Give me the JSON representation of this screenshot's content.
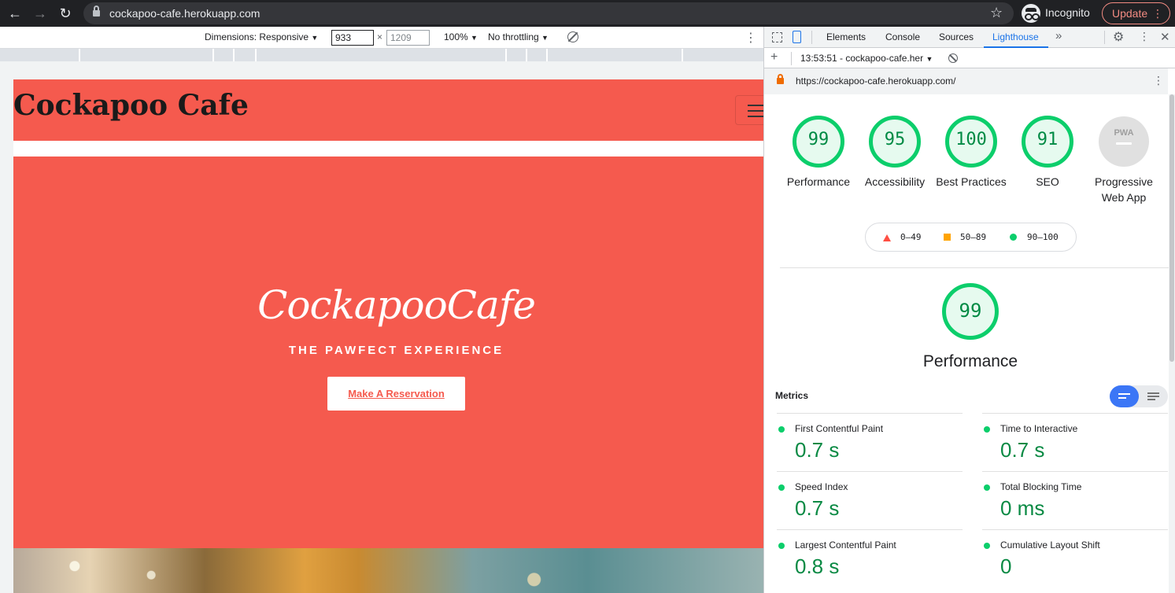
{
  "browser": {
    "url": "cockapoo-cafe.herokuapp.com",
    "incognito_label": "Incognito",
    "update_label": "Update"
  },
  "device_toolbar": {
    "dimensions_label": "Dimensions: Responsive",
    "width": "933",
    "height_placeholder": "1209",
    "zoom": "100%",
    "throttling": "No throttling"
  },
  "site": {
    "brand": "Cockapoo Cafe",
    "hero_logo": "CockapooCafe",
    "hero_tagline": "THE PAWFECT EXPERIENCE",
    "cta_label": "Make A Reservation",
    "brand_color": "#f55a4e"
  },
  "devtools": {
    "tabs": [
      "Elements",
      "Console",
      "Sources",
      "Lighthouse"
    ],
    "active_tab": "Lighthouse",
    "more_tabs": "»",
    "report_label": "13:53:51 - cockapoo-cafe.her",
    "report_url": "https://cockapoo-cafe.herokuapp.com/"
  },
  "lighthouse": {
    "categories": [
      {
        "label": "Performance",
        "score": "99"
      },
      {
        "label": "Accessibility",
        "score": "95"
      },
      {
        "label": "Best Practices",
        "score": "100"
      },
      {
        "label": "SEO",
        "score": "91"
      }
    ],
    "pwa_label": "Progressive Web App",
    "pwa_badge": "PWA",
    "legend": {
      "fail": "0–49",
      "average": "50–89",
      "pass": "90–100"
    },
    "performance_score": "99",
    "performance_title": "Performance",
    "metrics_heading": "Metrics",
    "metrics": [
      {
        "name": "First Contentful Paint",
        "value": "0.7 s"
      },
      {
        "name": "Time to Interactive",
        "value": "0.7 s"
      },
      {
        "name": "Speed Index",
        "value": "0.7 s"
      },
      {
        "name": "Total Blocking Time",
        "value": "0 ms"
      },
      {
        "name": "Largest Contentful Paint",
        "value": "0.8 s"
      },
      {
        "name": "Cumulative Layout Shift",
        "value": "0"
      }
    ],
    "pass_color": "#0cce6b",
    "average_color": "#ffa400",
    "fail_color": "#ff4e42"
  }
}
